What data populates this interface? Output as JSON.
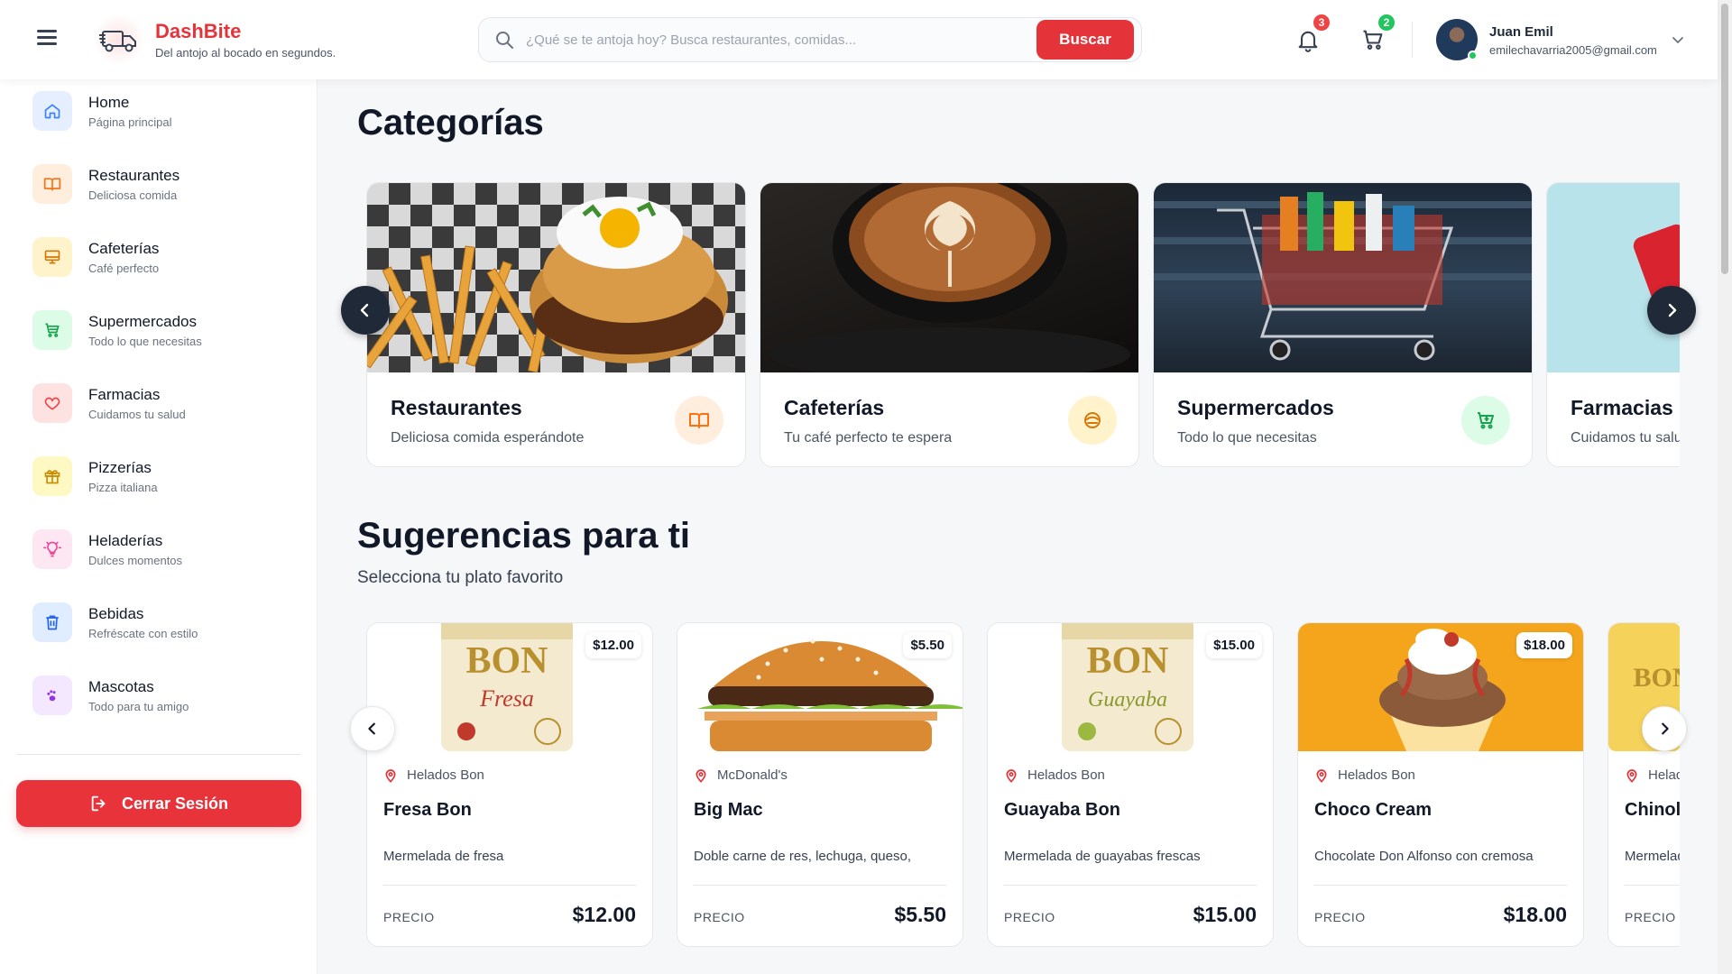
{
  "app": {
    "name": "DashBite",
    "tagline": "Del antojo al bocado en segundos."
  },
  "search": {
    "placeholder": "¿Qué se te antoja hoy? Busca restaurantes, comidas...",
    "button_label": "Buscar"
  },
  "header": {
    "notifications_count": "3",
    "cart_count": "2"
  },
  "user": {
    "name": "Juan Emil",
    "email": "emilechavarria2005@gmail.com"
  },
  "sidebar": {
    "items": [
      {
        "label": "Home",
        "sub": "Página principal",
        "icon": "home-icon",
        "color": "#3b82f6",
        "bg": "#e6efff"
      },
      {
        "label": "Restaurantes",
        "sub": "Deliciosa comida",
        "icon": "book-icon",
        "color": "#f97316",
        "bg": "#ffeedd"
      },
      {
        "label": "Cafeterías",
        "sub": "Café perfecto",
        "icon": "monitor-icon",
        "color": "#d97706",
        "bg": "#fff3cc"
      },
      {
        "label": "Supermercados",
        "sub": "Todo lo que necesitas",
        "icon": "cart-icon",
        "color": "#16a34a",
        "bg": "#dcfce7"
      },
      {
        "label": "Farmacias",
        "sub": "Cuidamos tu salud",
        "icon": "heart-icon",
        "color": "#ef4444",
        "bg": "#fee2e2"
      },
      {
        "label": "Pizzerías",
        "sub": "Pizza italiana",
        "icon": "gift-icon",
        "color": "#ca8a04",
        "bg": "#fef9c3"
      },
      {
        "label": "Heladerías",
        "sub": "Dulces momentos",
        "icon": "bulb-icon",
        "color": "#ec4899",
        "bg": "#fce7f3"
      },
      {
        "label": "Bebidas",
        "sub": "Refréscate con estilo",
        "icon": "trash-icon",
        "color": "#2563eb",
        "bg": "#e0ecff"
      },
      {
        "label": "Mascotas",
        "sub": "Todo para tu amigo",
        "icon": "paw-icon",
        "color": "#9333ea",
        "bg": "#f3e8ff"
      }
    ],
    "logout_label": "Cerrar Sesión"
  },
  "categories": {
    "title": "Categorías",
    "items": [
      {
        "title": "Restaurantes",
        "desc": "Deliciosa comida esperándote",
        "icon": "book-icon",
        "icon_color": "#f97316",
        "icon_bg": "#ffeedd"
      },
      {
        "title": "Cafeterías",
        "desc": "Tu café perfecto te espera",
        "icon": "coffee-icon",
        "icon_color": "#d97706",
        "icon_bg": "#fff3cc"
      },
      {
        "title": "Supermercados",
        "desc": "Todo lo que necesitas",
        "icon": "cart-plus-icon",
        "icon_color": "#16a34a",
        "icon_bg": "#dcfce7"
      },
      {
        "title": "Farmacias",
        "desc": "Cuidamos tu salud",
        "icon": "heart-icon",
        "icon_color": "#ef4444",
        "icon_bg": "#fee2e2"
      }
    ]
  },
  "suggestions": {
    "title": "Sugerencias para ti",
    "subtitle": "Selecciona tu plato favorito",
    "price_label": "PRECIO",
    "items": [
      {
        "store": "Helados Bon",
        "name": "Fresa Bon",
        "desc": "Mermelada de fresa",
        "price": "$12.00"
      },
      {
        "store": "McDonald's",
        "name": "Big Mac",
        "desc": "Doble carne de res, lechuga, queso,",
        "price": "$5.50"
      },
      {
        "store": "Helados Bon",
        "name": "Guayaba Bon",
        "desc": "Mermelada de guayabas frescas",
        "price": "$15.00"
      },
      {
        "store": "Helados Bon",
        "name": "Choco Cream",
        "desc": "Chocolate Don Alfonso con cremosa",
        "price": "$18.00"
      },
      {
        "store": "Helados Bon",
        "name": "Chinola Bon",
        "desc": "Mermelada de chinola",
        "price": ""
      }
    ]
  },
  "colors": {
    "brand": "#e5333a",
    "dark_nav": "#1f2937"
  }
}
